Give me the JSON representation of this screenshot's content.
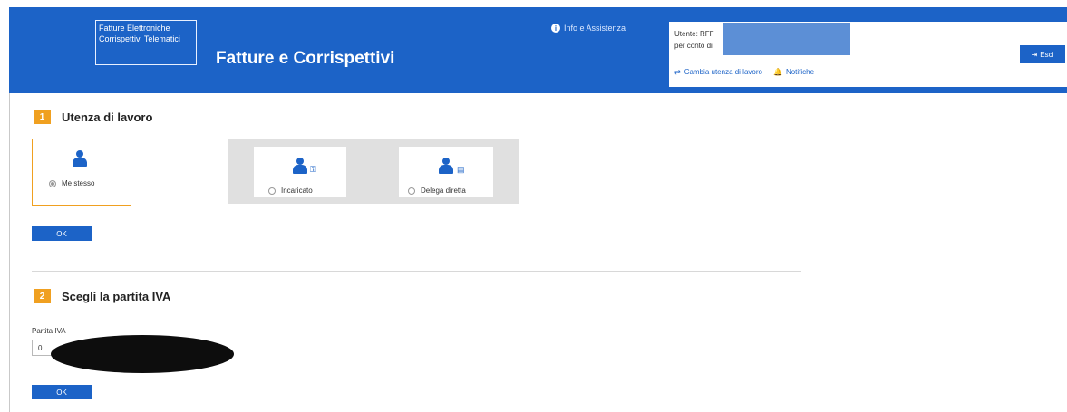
{
  "header": {
    "logo": {
      "line1": "Fatture Elettroniche",
      "line2": "Corrispettivi Telematici"
    },
    "title": "Fatture e Corrispettivi",
    "info_link": "Info e Assistenza",
    "user": {
      "utente_label": "Utente: RFF",
      "per_conto_label": "per conto di",
      "links": {
        "cambia": "Cambia utenza di lavoro",
        "notifiche": "Notifiche"
      },
      "esci_label": "Esci"
    }
  },
  "steps": [
    {
      "number": "1",
      "title": "Utenza di lavoro",
      "options": [
        {
          "label": "Me stesso",
          "checked": true,
          "icon": "person-icon"
        },
        {
          "label": "Incaricato",
          "checked": false,
          "icon": "person-key-icon"
        },
        {
          "label": "Delega diretta",
          "checked": false,
          "icon": "person-document-icon"
        }
      ],
      "ok_label": "OK"
    },
    {
      "number": "2",
      "title": "Scegli la partita IVA",
      "field_label": "Partita IVA",
      "field_value": "0",
      "ok_label": "OK"
    }
  ],
  "colors": {
    "brand": "#1c63c7",
    "accent": "#f0a020"
  }
}
